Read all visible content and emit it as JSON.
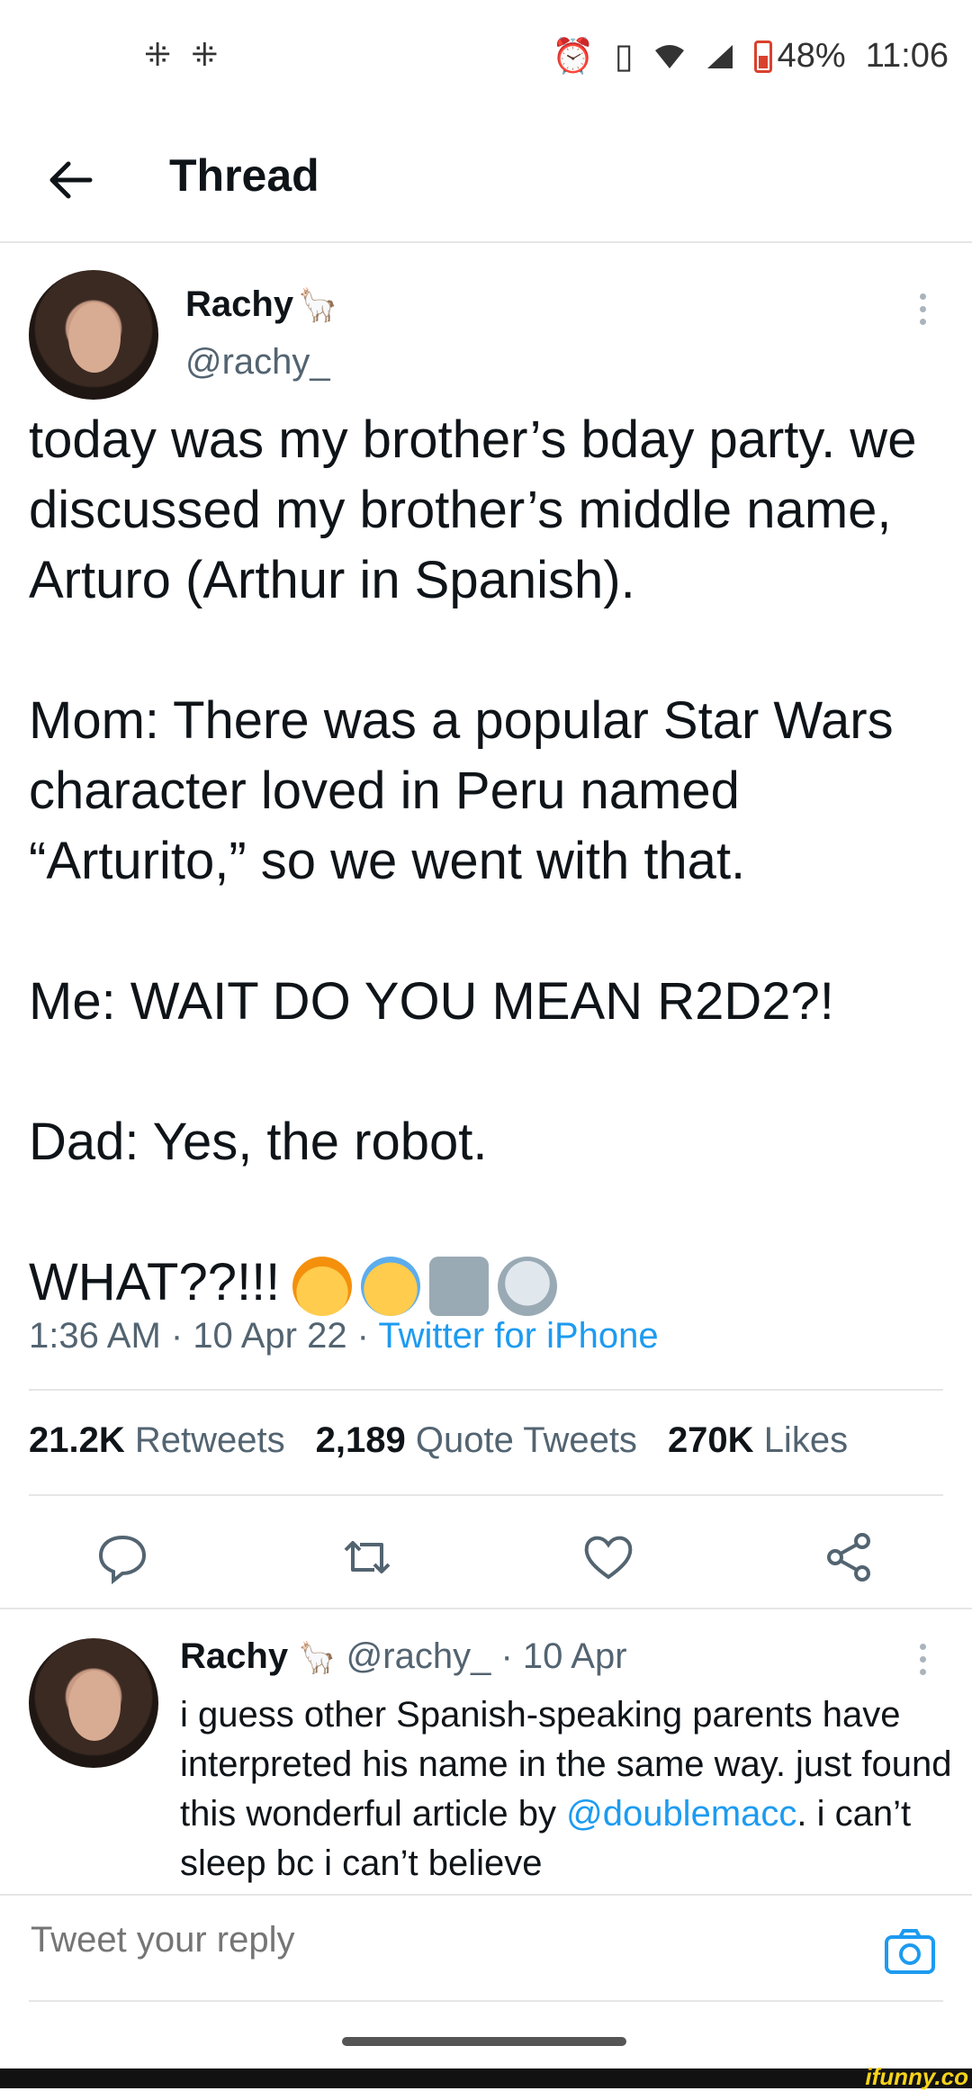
{
  "status_bar": {
    "notification_icons": [
      "slack-icon",
      "slack-icon"
    ],
    "battery": "48%",
    "time": "11:06"
  },
  "header": {
    "title": "Thread"
  },
  "tweet": {
    "name": "Rachy",
    "name_emoji": "llama-icon",
    "handle": "@rachy_",
    "text": "today was my brother’s bday party. we discussed my brother’s middle name, Arturo (Arthur in Spanish).\n\nMom: There was a popular Star Wars character loved in Peru named “Arturito,” so we went with that.\n\nMe: WAIT DO YOU MEAN R2D2?!\n\nDad: Yes, the robot.\n\n",
    "last_line": "WHAT??!!!",
    "emojis": [
      "exploding-head-emoji",
      "loudly-crying-emoji",
      "robot-emoji",
      "skull-crossbones-emoji"
    ],
    "time": "1:36 AM",
    "date": "10 Apr 22",
    "source": "Twitter for iPhone",
    "sep": " · ",
    "retweets_count": "21.2K",
    "retweets_label": "Retweets",
    "quotes_count": "2,189",
    "quotes_label": "Quote Tweets",
    "likes_count": "270K",
    "likes_label": "Likes"
  },
  "reply": {
    "name": "Rachy",
    "handle": "@rachy_",
    "date": "· 10 Apr",
    "text_part1": "i guess other Spanish-speaking parents have interpreted his name in the same way. just found this wonderful article by ",
    "mention": "@doublemacc",
    "text_part2": ". i can’t sleep bc i can’t believe"
  },
  "composer": {
    "placeholder": "Tweet your reply"
  },
  "watermark": "ifunny.co",
  "colors": {
    "accent": "#1d9bf0",
    "text": "#0f1419",
    "secondary": "#536471"
  }
}
